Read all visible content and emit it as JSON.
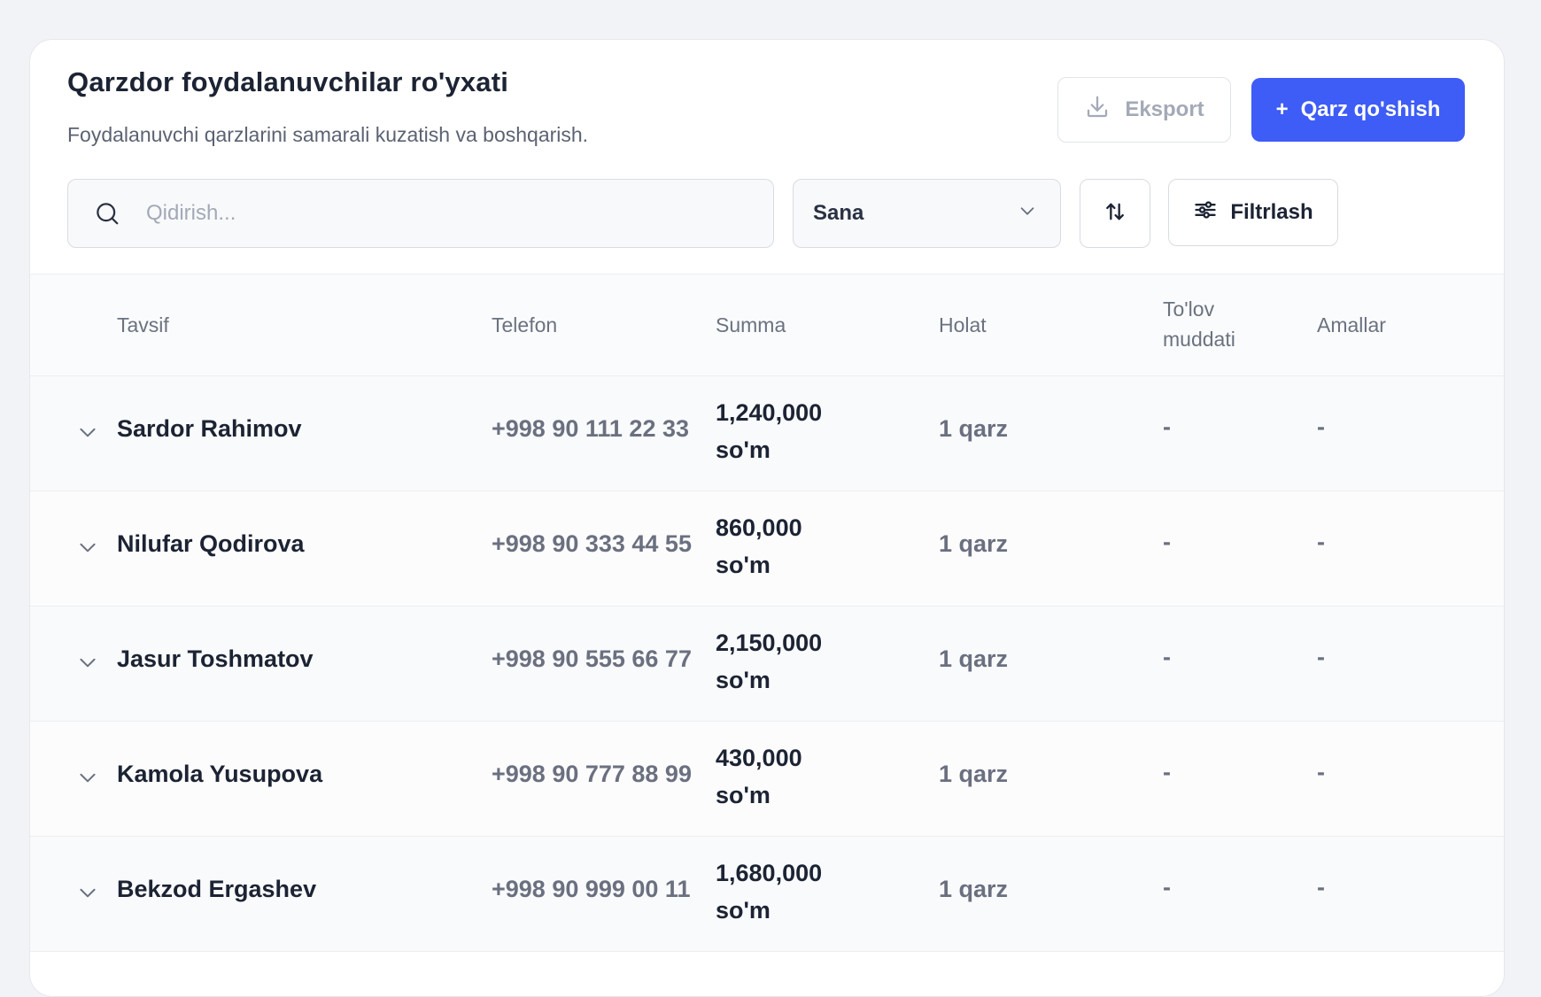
{
  "header": {
    "title": "Qarzdor foydalanuvchilar ro'yxati",
    "subtitle": "Foydalanuvchi qarzlarini samarali kuzatish va boshqarish.",
    "export_label": "Eksport",
    "export_icon": "download-icon",
    "add_label": "Qarz qo'shish",
    "add_icon": "plus-icon"
  },
  "toolbar": {
    "search_placeholder": "Qidirish...",
    "search_value": "",
    "search_icon": "search-icon",
    "sort_field": "Sana",
    "sort_toggle_icon": "sort-arrows-icon",
    "filter_label": "Filtrlash",
    "filter_icon": "sliders-icon"
  },
  "table": {
    "columns": {
      "description": "Tavsif",
      "phone": "Telefon",
      "amount": "Summa",
      "status": "Holat",
      "due_line1": "To'lov",
      "due_line2": "muddati",
      "actions": "Amallar"
    },
    "rows": [
      {
        "name": "Sardor Rahimov",
        "phone": "+998 90 111 22 33",
        "amount": "1,240,000",
        "currency": "so'm",
        "status": "1 qarz",
        "due": "-",
        "actions": "-"
      },
      {
        "name": "Nilufar Qodirova",
        "phone": "+998 90 333 44 55",
        "amount": "860,000",
        "currency": "so'm",
        "status": "1 qarz",
        "due": "-",
        "actions": "-"
      },
      {
        "name": "Jasur Toshmatov",
        "phone": "+998 90 555 66 77",
        "amount": "2,150,000",
        "currency": "so'm",
        "status": "1 qarz",
        "due": "-",
        "actions": "-"
      },
      {
        "name": "Kamola Yusupova",
        "phone": "+998 90 777 88 99",
        "amount": "430,000",
        "currency": "so'm",
        "status": "1 qarz",
        "due": "-",
        "actions": "-"
      },
      {
        "name": "Bekzod Ergashev",
        "phone": "+998 90 999 00 11",
        "amount": "1,680,000",
        "currency": "so'm",
        "status": "1 qarz",
        "due": "-",
        "actions": "-"
      }
    ]
  },
  "colors": {
    "accent": "#3e5cf6",
    "background": "#f2f3f6",
    "card": "#ffffff",
    "text_primary": "#1c2333",
    "text_secondary": "#6b7080"
  }
}
